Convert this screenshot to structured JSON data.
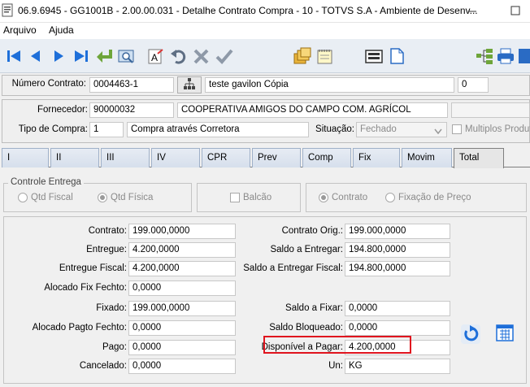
{
  "window": {
    "title": "06.9.6945 - GG1001B - 2.00.00.031 - Detalhe Contrato Compra - 10 - TOTVS S.A - Ambiente de Desenv..."
  },
  "menu": {
    "items": [
      "Arquivo",
      "Ajuda"
    ]
  },
  "toolbar": {
    "icons": [
      "first-record-icon",
      "previous-record-icon",
      "next-record-icon",
      "last-record-icon",
      "go-to-icon",
      "search-icon",
      "spelling-icon",
      "undo-icon",
      "cancel-icon",
      "confirm-icon",
      "copy-records-icon",
      "notes-icon",
      "form-icon",
      "document-icon",
      "tree-icon",
      "print-icon",
      "exit-icon"
    ]
  },
  "header": {
    "contract_label": "Número Contrato:",
    "contract_value": "0004463-1",
    "contract_desc": "teste gavilon Cópia",
    "contract_extra": "0"
  },
  "supplier": {
    "supplier_label": "Fornecedor:",
    "supplier_code": "90000032",
    "supplier_name": "COOPERATIVA AMIGOS DO CAMPO COM. AGRÍCOL",
    "purchase_type_label": "Tipo de Compra:",
    "purchase_type_code": "1",
    "purchase_type_desc": "Compra através Corretora",
    "situation_label": "Situação:",
    "situation_value": "Fechado",
    "multiple_products_label": "Multiplos Produto"
  },
  "tabs": [
    "I",
    "II",
    "III",
    "IV",
    "CPR",
    "Prev",
    "Comp",
    "Fix",
    "Movim",
    "Total"
  ],
  "active_tab": "Total",
  "delivery_control": {
    "title": "Controle Entrega",
    "options": [
      "Qtd Fiscal",
      "Qtd Física"
    ],
    "selected": "Qtd Física",
    "balcao_label": "Balcão",
    "basis_options": [
      "Contrato",
      "Fixação de Preço"
    ],
    "basis_selected": "Contrato"
  },
  "totals": {
    "left": [
      {
        "label": "Contrato:",
        "value": "199.000,0000"
      },
      {
        "label": "Entregue:",
        "value": "4.200,0000"
      },
      {
        "label": "Entregue Fiscal:",
        "value": "4.200,0000"
      },
      {
        "label": "Alocado Fix Fechto:",
        "value": "0,0000"
      },
      {
        "label": "Fixado:",
        "value": "199.000,0000"
      },
      {
        "label": "Alocado Pagto Fechto:",
        "value": "0,0000"
      },
      {
        "label": "Pago:",
        "value": "0,0000"
      },
      {
        "label": "Cancelado:",
        "value": "0,0000"
      }
    ],
    "right": [
      {
        "label": "Contrato Orig.:",
        "value": "199.000,0000"
      },
      {
        "label": "Saldo a Entregar:",
        "value": "194.800,0000"
      },
      {
        "label": "Saldo a Entregar Fiscal:",
        "value": "194.800,0000"
      },
      {
        "label": "Saldo a Fixar:",
        "value": "0,0000"
      },
      {
        "label": "Saldo Bloqueado:",
        "value": "0,0000"
      },
      {
        "label": "Disponível a Pagar:",
        "value": "4.200,0000"
      },
      {
        "label": "Un:",
        "value": "KG"
      }
    ]
  },
  "colors": {
    "highlight": "#e0141e",
    "toolbar_blue": "#1e6fd9",
    "accent_green": "#6ea53a"
  }
}
